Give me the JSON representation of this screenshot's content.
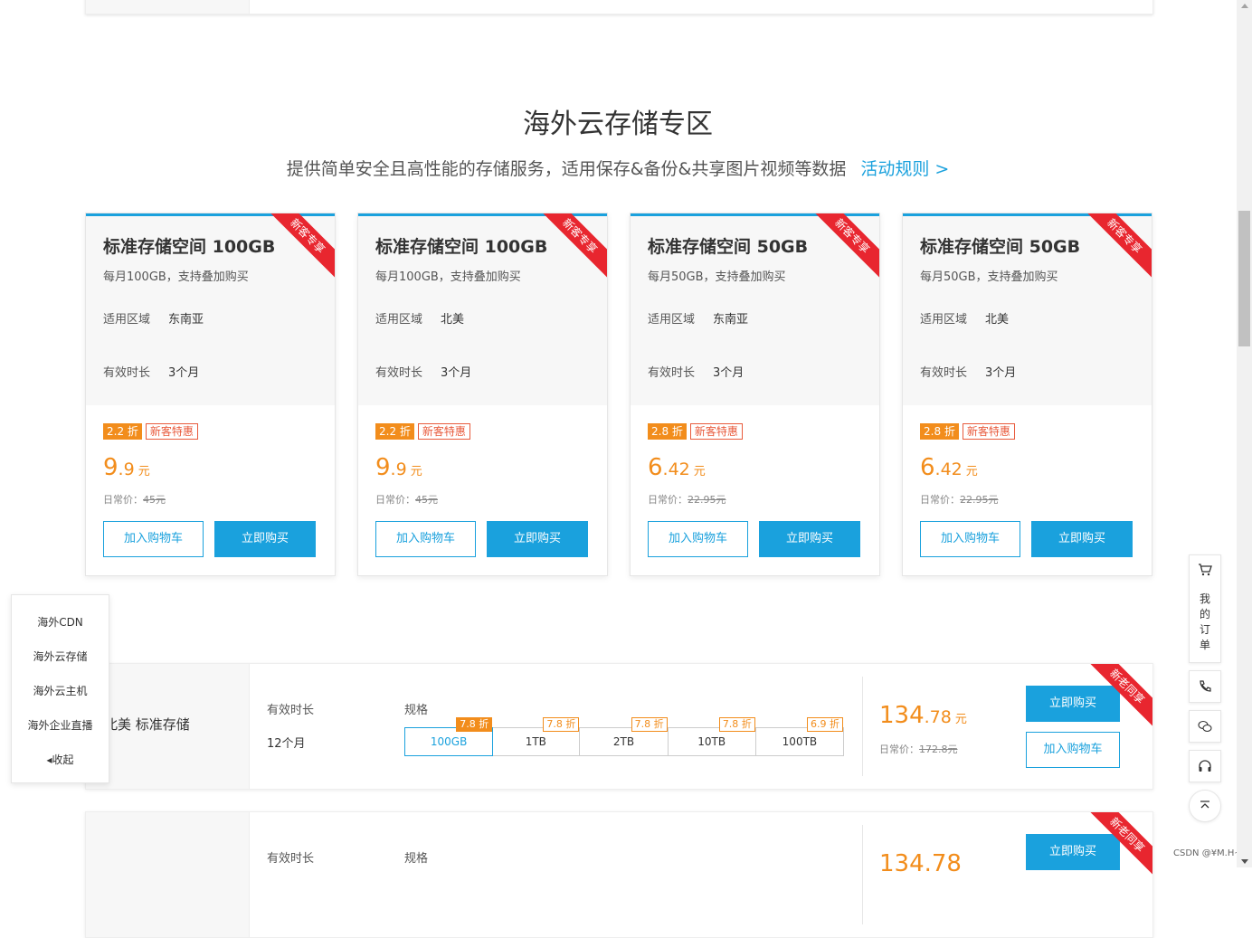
{
  "section": {
    "title": "海外云存储专区",
    "subtitle": "提供简单安全且高性能的存储服务，适用保存&备份&共享图片视频等数据",
    "rules_link": "活动规则 >"
  },
  "cards": [
    {
      "ribbon": "新客专享",
      "title": "标准存储空间 100GB",
      "desc": "每月100GB，支持叠加购买",
      "region_label": "适用区域",
      "region": "东南亚",
      "duration_label": "有效时长",
      "duration": "3个月",
      "discount": "2.2 折",
      "tag": "新客特惠",
      "price_int": "9",
      "price_dec": ".9",
      "unit": "元",
      "orig_label": "日常价：",
      "orig": "45元",
      "cart": "加入购物车",
      "buy": "立即购买"
    },
    {
      "ribbon": "新客专享",
      "title": "标准存储空间 100GB",
      "desc": "每月100GB，支持叠加购买",
      "region_label": "适用区域",
      "region": "北美",
      "duration_label": "有效时长",
      "duration": "3个月",
      "discount": "2.2 折",
      "tag": "新客特惠",
      "price_int": "9",
      "price_dec": ".9",
      "unit": "元",
      "orig_label": "日常价：",
      "orig": "45元",
      "cart": "加入购物车",
      "buy": "立即购买"
    },
    {
      "ribbon": "新客专享",
      "title": "标准存储空间 50GB",
      "desc": "每月50GB，支持叠加购买",
      "region_label": "适用区域",
      "region": "东南亚",
      "duration_label": "有效时长",
      "duration": "3个月",
      "discount": "2.8 折",
      "tag": "新客特惠",
      "price_int": "6",
      "price_dec": ".42",
      "unit": "元",
      "orig_label": "日常价：",
      "orig": "22.95元",
      "cart": "加入购物车",
      "buy": "立即购买"
    },
    {
      "ribbon": "新客专享",
      "title": "标准存储空间 50GB",
      "desc": "每月50GB，支持叠加购买",
      "region_label": "适用区域",
      "region": "北美",
      "duration_label": "有效时长",
      "duration": "3个月",
      "discount": "2.8 折",
      "tag": "新客特惠",
      "price_int": "6",
      "price_dec": ".42",
      "unit": "元",
      "orig_label": "日常价：",
      "orig": "22.95元",
      "cart": "加入购物车",
      "buy": "立即购买"
    }
  ],
  "product1": {
    "name": "北美 标准存储",
    "duration_label": "有效时长",
    "duration": "12个月",
    "spec_label": "规格",
    "specs": [
      {
        "label": "100GB",
        "discount": "7.8 折"
      },
      {
        "label": "1TB",
        "discount": "7.8 折"
      },
      {
        "label": "2TB",
        "discount": "7.8 折"
      },
      {
        "label": "10TB",
        "discount": "7.8 折"
      },
      {
        "label": "100TB",
        "discount": "6.9 折"
      }
    ],
    "price_int": "134",
    "price_dec": ".78",
    "unit": "元",
    "orig_label": "日常价：",
    "orig": "172.8元",
    "buy": "立即购买",
    "cart": "加入购物车",
    "ribbon": "新老同享"
  },
  "product2": {
    "duration_label": "有效时长",
    "spec_label": "规格",
    "price_partial": "134.78",
    "buy": "立即购买",
    "ribbon": "新老同享"
  },
  "side_nav": {
    "items": [
      "海外CDN",
      "海外云存储",
      "海外云主机",
      "海外企业直播"
    ],
    "collapse": "◂收起"
  },
  "float_bar": {
    "orders": [
      "我",
      "的",
      "订",
      "单"
    ]
  },
  "watermark": "CSDN @¥M.H~"
}
